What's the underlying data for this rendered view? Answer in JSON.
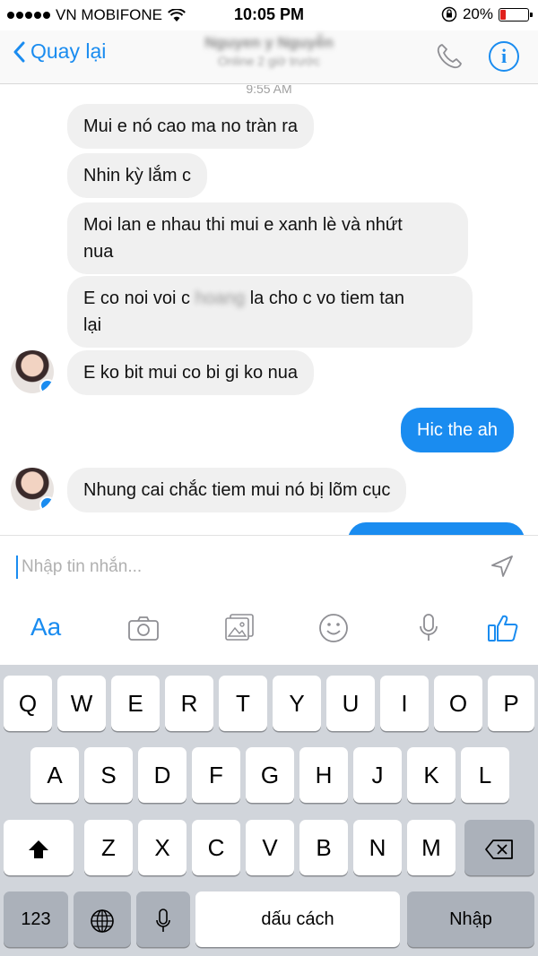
{
  "status_bar": {
    "carrier": "VN MOBIFONE",
    "time": "10:05 PM",
    "battery": "20%",
    "battery_level": 0.2
  },
  "nav": {
    "back_label": "Quay lại",
    "contact_name": "Nguyen y Nguyễn",
    "contact_status": "Online 2 giờ trước"
  },
  "chat": {
    "timestamp": "9:55 AM",
    "messages": [
      {
        "direction": "in",
        "text": "Mui e nó cao ma no tràn ra"
      },
      {
        "direction": "in",
        "text": "Nhin kỳ lắm c"
      },
      {
        "direction": "in",
        "text_line1": "Moi lan e nhau thi mui e xanh lè và nhứt",
        "text_line2": "nua"
      },
      {
        "direction": "in",
        "text_before": "E co noi voi c",
        "text_blurred": "hoang",
        "text_after": "la cho c vo tiem tan",
        "text_line2": "lại"
      },
      {
        "direction": "in",
        "text": "E ko bit mui co bi gi ko nua"
      },
      {
        "direction": "out",
        "text": "Hic the ah"
      },
      {
        "direction": "in",
        "text": "Nhung cai chắc tiem mui nó bị lõm cục"
      }
    ]
  },
  "composer": {
    "placeholder": "Nhập tin nhắn...",
    "aa_label": "Aa"
  },
  "keyboard": {
    "row1": [
      "Q",
      "W",
      "E",
      "R",
      "T",
      "Y",
      "U",
      "I",
      "O",
      "P"
    ],
    "row2": [
      "A",
      "S",
      "D",
      "F",
      "G",
      "H",
      "J",
      "K",
      "L"
    ],
    "row3": [
      "Z",
      "X",
      "C",
      "V",
      "B",
      "N",
      "M"
    ],
    "numbers_label": "123",
    "space_label": "dấu cách",
    "return_label": "Nhập"
  },
  "colors": {
    "accent": "#1a8cf0",
    "incoming_bubble": "#f0f0f0",
    "keyboard_bg": "#d1d5db"
  }
}
